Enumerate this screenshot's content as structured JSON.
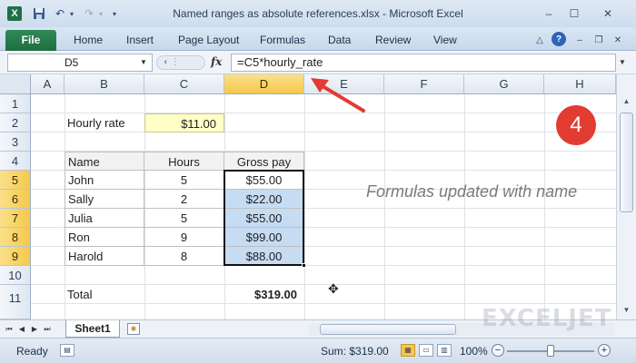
{
  "window": {
    "title": "Named ranges as absolute references.xlsx - Microsoft Excel",
    "app_icon": "excel-icon",
    "controls": {
      "minimize": "‒",
      "maximize": "☐",
      "close": "✕"
    }
  },
  "ribbon": {
    "file_tab": "File",
    "tabs": [
      "Home",
      "Insert",
      "Page Layout",
      "Formulas",
      "Data",
      "Review",
      "View"
    ]
  },
  "formula_bar": {
    "name_box": "D5",
    "fx": "fx",
    "formula": "=C5*hourly_rate"
  },
  "grid": {
    "columns": [
      "A",
      "B",
      "C",
      "D",
      "E",
      "F",
      "G",
      "H"
    ],
    "selected_column": "D",
    "rows": [
      "1",
      "2",
      "3",
      "4",
      "5",
      "6",
      "7",
      "8",
      "9",
      "10",
      "11"
    ],
    "selected_rows": [
      "5",
      "6",
      "7",
      "8",
      "9"
    ]
  },
  "sheet": {
    "rate_label": "Hourly rate",
    "rate_value": "$11.00",
    "table": {
      "headers": [
        "Name",
        "Hours",
        "Gross pay"
      ],
      "rows": [
        [
          "John",
          "5",
          "$55.00"
        ],
        [
          "Sally",
          "2",
          "$22.00"
        ],
        [
          "Julia",
          "5",
          "$55.00"
        ],
        [
          "Ron",
          "9",
          "$99.00"
        ],
        [
          "Harold",
          "8",
          "$88.00"
        ]
      ]
    },
    "total_label": "Total",
    "total_value": "$319.00"
  },
  "annotation": {
    "step_number": "4",
    "note": "Formulas updated with name",
    "accent_color": "#e23b32"
  },
  "sheet_tabs": {
    "active": "Sheet1"
  },
  "status_bar": {
    "mode": "Ready",
    "sum": "Sum: $319.00",
    "zoom": "100%"
  },
  "watermark": "EXCELJET"
}
